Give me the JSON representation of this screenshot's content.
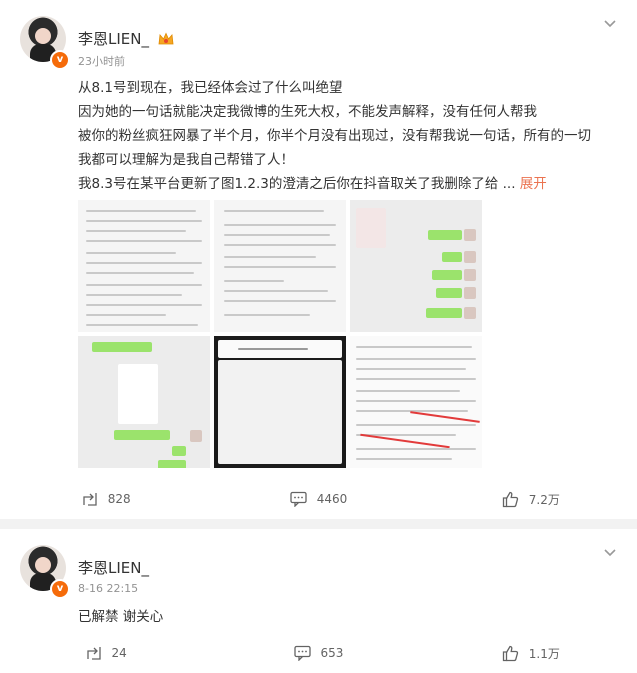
{
  "posts": [
    {
      "author": "李恩LIEN_",
      "time": "23小时前",
      "lines": [
        "从8.1号到现在，我已经体会过了什么叫绝望",
        "因为她的一句话就能决定我微博的生死大权，不能发声解释，没有任何人帮我",
        "被你的粉丝疯狂网暴了半个月，你半个月没有出现过，没有帮我说一句话，所有的一切",
        "我都可以理解为是我自己帮错了人！",
        "我8.3号在某平台更新了图1.2.3的澄清之后你在抖音取关了我删除了给 ..."
      ],
      "expand_label": "展开",
      "repost_count": "828",
      "comment_count": "4460",
      "like_count": "7.2万"
    },
    {
      "author": "李恩LIEN_",
      "time": "8-16 22:15",
      "lines": [
        "已解禁 谢关心"
      ],
      "repost_count": "24",
      "comment_count": "653",
      "like_count": "1.1万"
    }
  ],
  "icons": {
    "verified": "verified-badge-icon",
    "crown": "vip-crown-icon",
    "menu": "chevron-down-icon",
    "repost": "repost-icon",
    "comment": "comment-icon",
    "like": "like-icon"
  },
  "colors": {
    "accent": "#eb7350",
    "badge": "#f56b0a",
    "text": "#333333",
    "muted": "#939393"
  }
}
